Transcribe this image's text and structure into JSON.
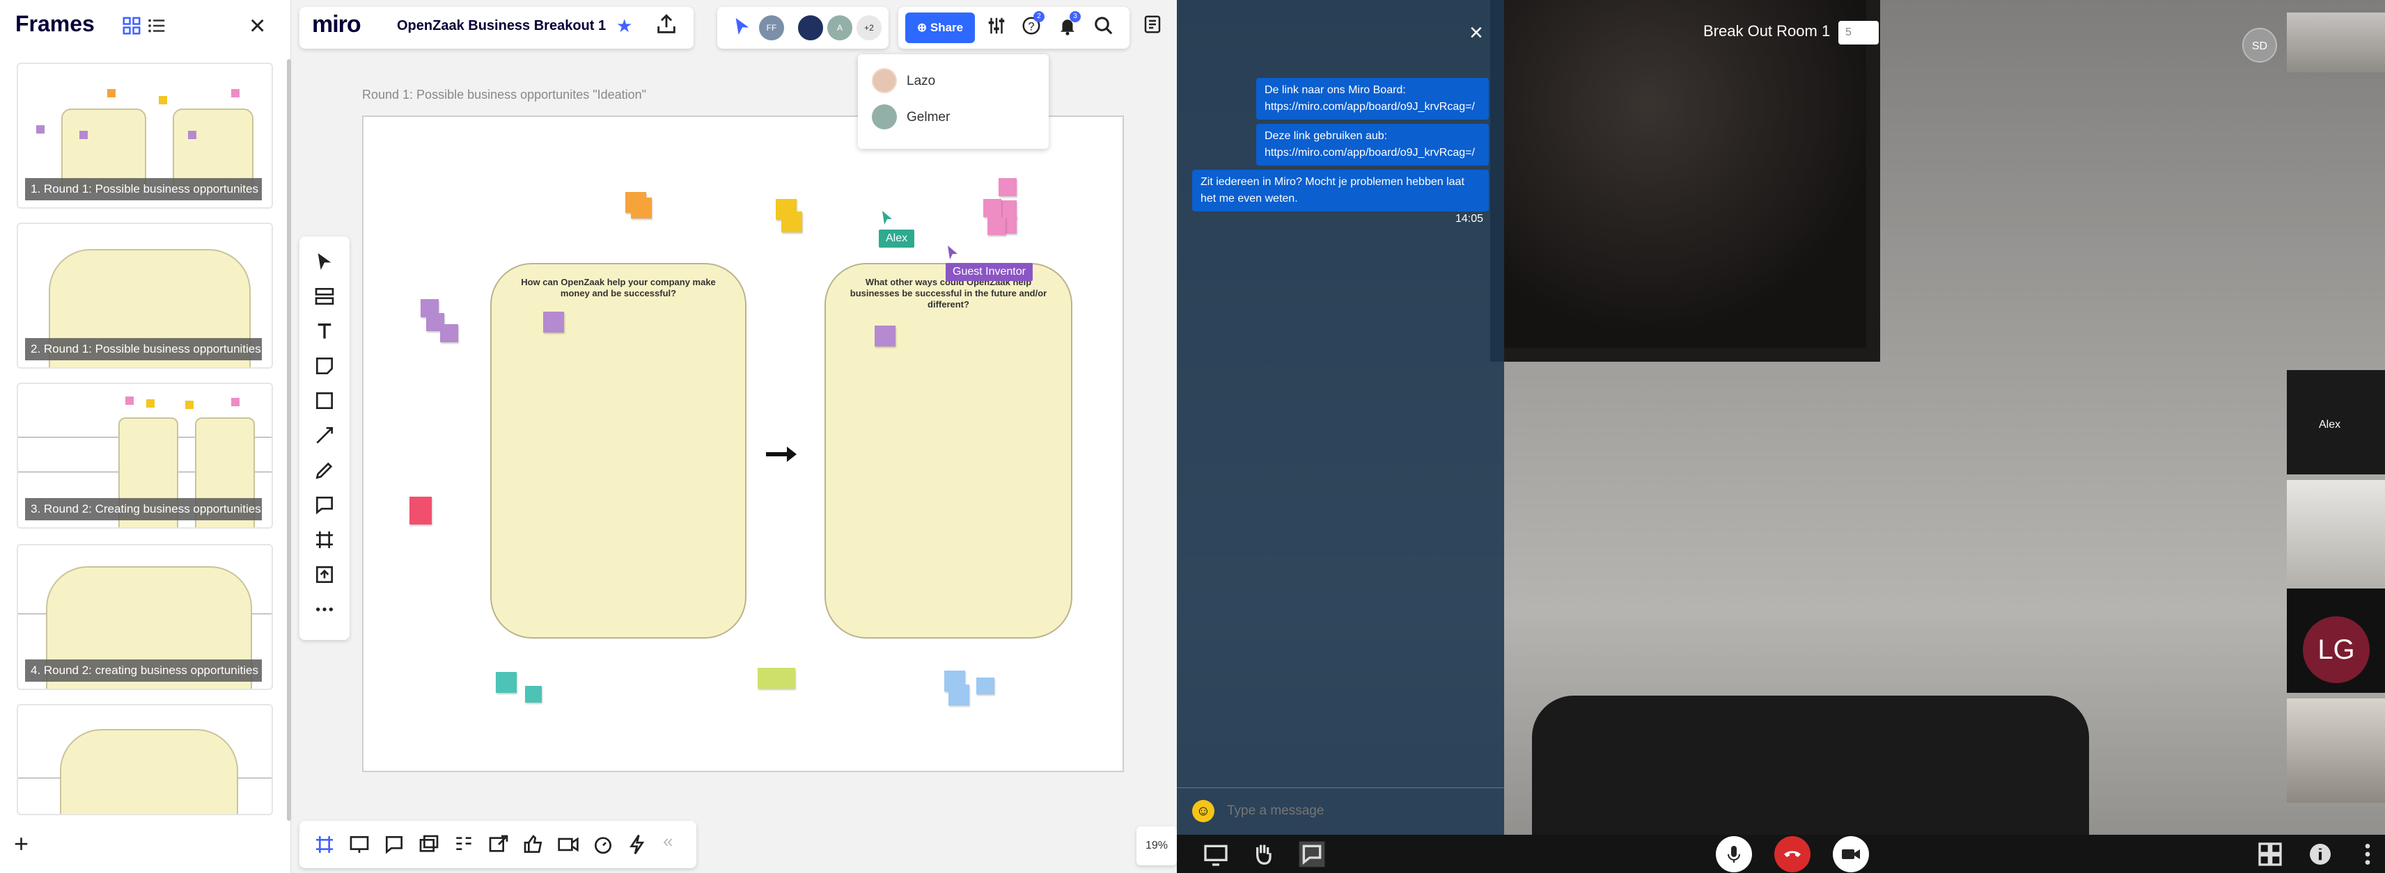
{
  "frames_panel": {
    "title": "Frames",
    "thumbnails": [
      {
        "label": "1. Round 1: Possible business opportunites"
      },
      {
        "label": "2. Round 1: Possible business opportunities"
      },
      {
        "label": "3. Round 2: Creating business opportunities"
      },
      {
        "label": "4. Round 2: creating business opportunities"
      },
      {
        "label": ""
      }
    ]
  },
  "toolbar": {
    "logo": "miro",
    "board_title": "OpenZaak Business Breakout 1",
    "star": "★",
    "share_label": "Share",
    "more_users": "+2",
    "avatar_ff": "FF",
    "avatar_a": "A",
    "help_badge": "2",
    "notif_badge": "3"
  },
  "user_dropdown": {
    "users": [
      {
        "name": "Lazo"
      },
      {
        "name": "Gelmer"
      }
    ]
  },
  "board": {
    "frame_caption": "Round 1: Possible business opportunites  \"Ideation\"",
    "left_question": "How can OpenZaak help your company make money and be successful?",
    "right_question": "What other ways could OpenZaak help businesses be successful in the future and/or different?",
    "cursor_alex": "Alex",
    "cursor_guest": "Guest Inventor",
    "zoom": "19%"
  },
  "chat": {
    "messages": [
      {
        "text": "De link naar ons Miro Board: https://miro.com/app/board/o9J_krvRcag=/"
      },
      {
        "text": "Deze link gebruiken aub: https://miro.com/app/board/o9J_krvRcag=/"
      },
      {
        "text": "Zit iedereen in Miro? Mocht je problemen hebben laat het me even weten."
      }
    ],
    "time": "14:05",
    "input_placeholder": "Type a message"
  },
  "call": {
    "room_title": "Break Out Room 1",
    "participant_count": "5",
    "sd_initials": "SD",
    "alex_name": "Alex",
    "lg_initials": "LG"
  },
  "colors": {
    "accent": "#2d68ff",
    "frame_fill": "#f7f2c6",
    "chat_bubble": "#0b5fcf",
    "hangup": "#d92b2b"
  }
}
